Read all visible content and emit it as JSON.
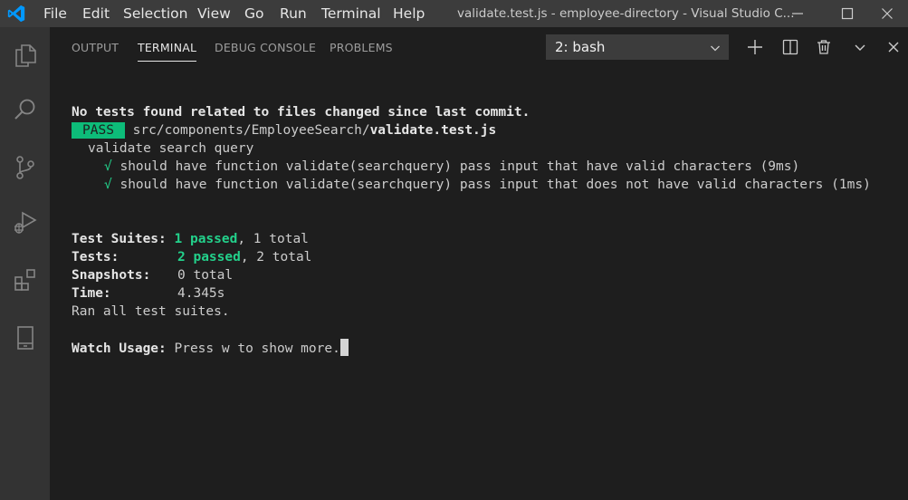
{
  "window": {
    "title": "validate.test.js - employee-directory - Visual Studio C..."
  },
  "menu": {
    "items": [
      "File",
      "Edit",
      "Selection",
      "View",
      "Go",
      "Run",
      "Terminal",
      "Help"
    ]
  },
  "panel": {
    "tabs": [
      "OUTPUT",
      "TERMINAL",
      "DEBUG CONSOLE",
      "PROBLEMS"
    ],
    "active_tab": "TERMINAL",
    "terminal_select": "2: bash"
  },
  "terminal": {
    "no_tests": "No tests found related to files changed since last commit.",
    "pass_badge": "PASS",
    "path_prefix": "src/components/EmployeeSearch/",
    "file_name": "validate.test.js",
    "describe": "validate search query",
    "check_mark": "√",
    "test1": "should have function validate(searchquery) pass input that have valid characters (9ms)",
    "test2": "should have function validate(searchquery) pass input that does not have valid characters (1ms)",
    "suites_label": "Test Suites:",
    "suites_passed": "1 passed",
    "suites_total": ", 1 total",
    "tests_label": "Tests:",
    "tests_passed": "2 passed",
    "tests_total": ", 2 total",
    "snapshots_label": "Snapshots:",
    "snapshots_value": "0 total",
    "time_label": "Time:",
    "time_value": "4.345s",
    "ran_all": "Ran all test suites.",
    "watch_label": "Watch Usage:",
    "watch_text": " Press w to show more."
  },
  "colors": {
    "pass_green": "#0dbc79",
    "passed_text": "#23d18b",
    "vscode_blue": "#0098ff"
  }
}
